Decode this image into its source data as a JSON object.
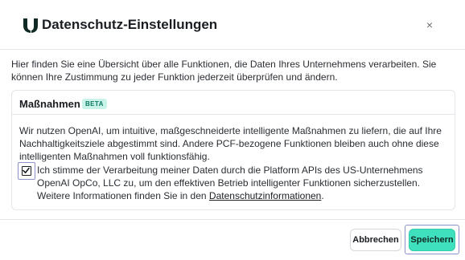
{
  "dialog": {
    "title": "Datenschutz-Einstellungen",
    "close_label": "×",
    "intro": "Hier finden Sie eine Übersicht über alle Funktionen, die Daten Ihres Unternehmens verarbeiten. Sie können Ihre Zustimmung zu jeder Funktion jederzeit überprüfen und ändern."
  },
  "section": {
    "title": "Maßnahmen",
    "badge": "BETA",
    "description": "Wir nutzen OpenAI, um intuitive, maßgeschneiderte intelligente Maßnahmen zu liefern, die auf Ihre Nachhaltigkeitsziele abgestimmt sind. Andere PCF-bezogene Funktionen bleiben auch ohne diese intelligenten Maßnahmen voll funktionsfähig.",
    "consent_checked": true,
    "consent_text": "Ich stimme der Verarbeitung meiner Daten durch die Platform APIs des US-Unternehmens OpenAI OpCo, LLC zu, um den effektiven Betrieb intelligenter Funktionen sicherzustellen. Weitere Informationen finden Sie in den ",
    "consent_link": "Datenschutzinformationen",
    "consent_end": "."
  },
  "footer": {
    "cancel_label": "Abbrechen",
    "save_label": "Speichern"
  },
  "colors": {
    "accent": "#3fe0bd",
    "badge_bg": "#c9f3e9",
    "badge_text": "#0b7a64",
    "focus_ring": "#8d93c8",
    "logo": "#0f2a24"
  }
}
